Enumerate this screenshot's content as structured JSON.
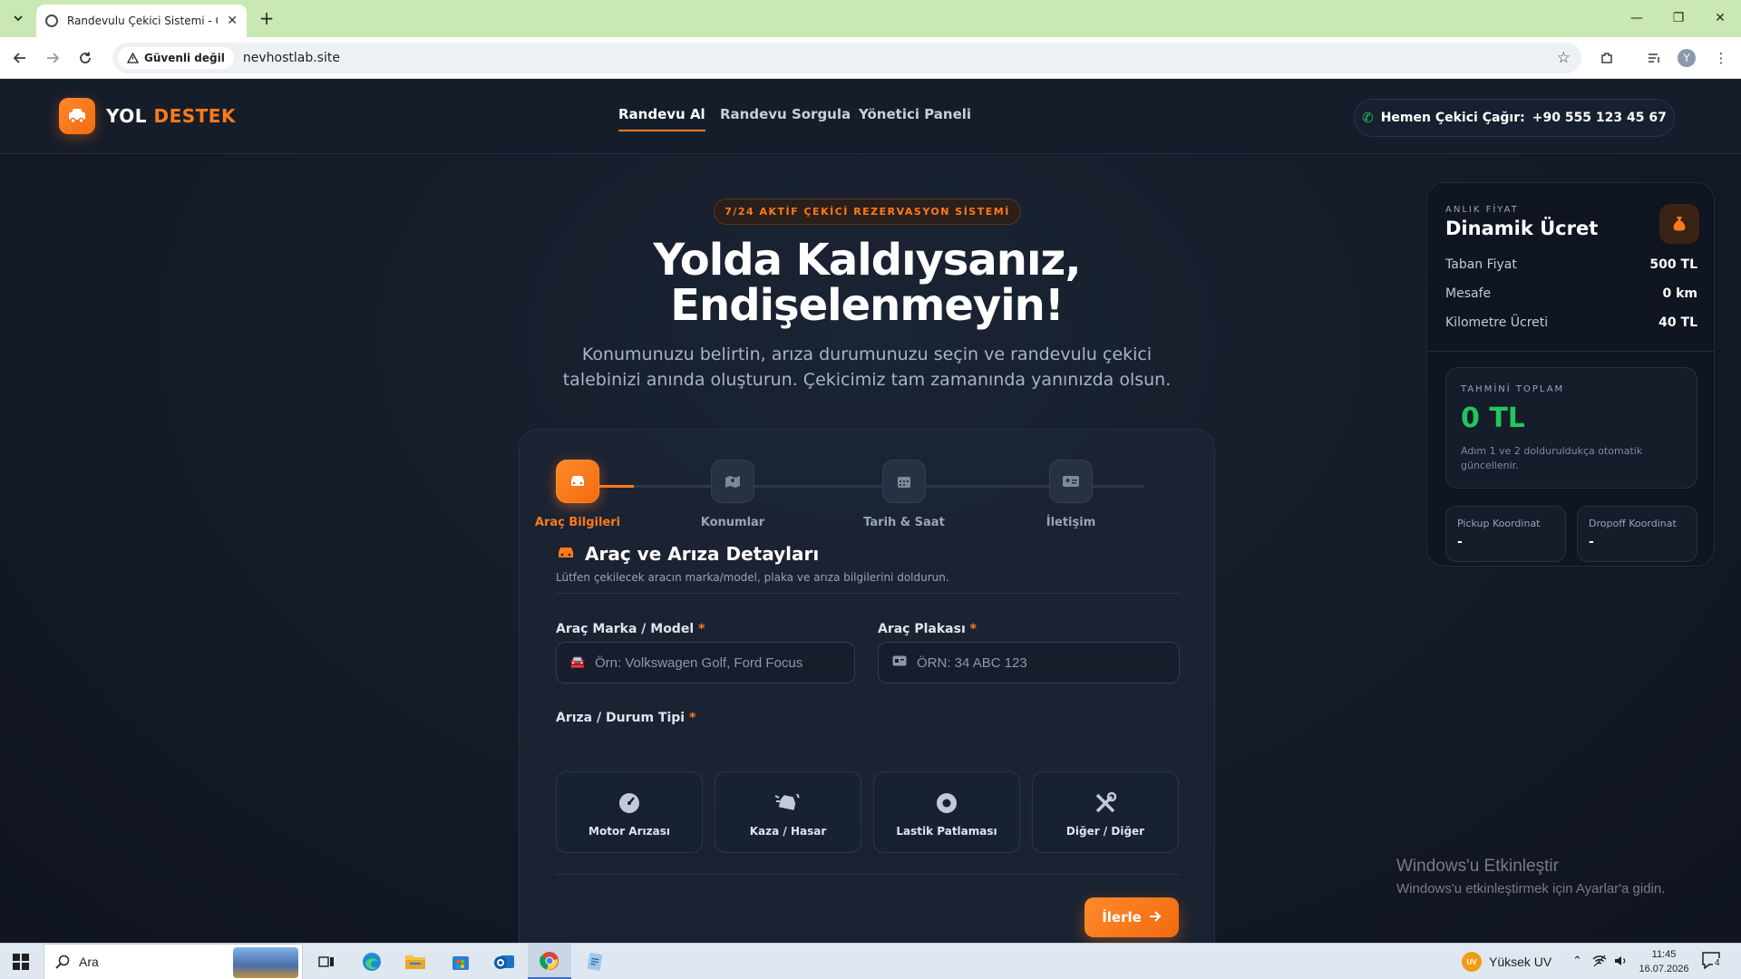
{
  "browser": {
    "tab_title": "Randevulu Çekici Sistemi - Güv",
    "security_label": "Güvenli değil",
    "url": "nevhostlab.site",
    "profile_initial": "Y"
  },
  "site": {
    "logo_word1": "YOL",
    "logo_word2": "DESTEK",
    "nav": [
      "Randevu Al",
      "Randevu Sorgula",
      "Yönetici Paneli"
    ],
    "call_label": "Hemen Çekici Çağır:",
    "call_number": "+90 555 123 45 67"
  },
  "hero": {
    "badge": "7/24 AKTİF ÇEKİCİ REZERVASYON SİSTEMİ",
    "title_line1": "Yolda Kaldıysanız,",
    "title_line2": "Endişelenmeyin!",
    "subtitle": "Konumunuzu belirtin, arıza durumunuzu seçin ve randevulu çekici talebinizi anında oluşturun. Çekicimiz tam zamanında yanınızda olsun."
  },
  "steps": [
    "Araç Bilgileri",
    "Konumlar",
    "Tarih & Saat",
    "İletişim"
  ],
  "form": {
    "section_title": "Araç ve Arıza Detayları",
    "section_desc": "Lütfen çekilecek aracın marka/model, plaka ve arıza bilgilerini doldurun.",
    "brand_label": "Araç Marka / Model",
    "brand_placeholder": "Örn: Volkswagen Golf, Ford Focus",
    "plate_label": "Araç Plakası",
    "plate_placeholder": "ÖRN: 34 ABC 123",
    "required_mark": "*",
    "fault_label": "Arıza / Durum Tipi",
    "fault_options": [
      "Motor Arızası",
      "Kaza / Hasar",
      "Lastik Patlaması",
      "Diğer / Diğer"
    ],
    "next_label": "İlerle"
  },
  "pricing": {
    "kicker": "ANLIK FİYAT",
    "title": "Dinamik Ücret",
    "rows": [
      {
        "label": "Taban Fiyat",
        "value": "500 TL"
      },
      {
        "label": "Mesafe",
        "value": "0 km"
      },
      {
        "label": "Kilometre Ücreti",
        "value": "40 TL"
      }
    ],
    "total_label": "TAHMİNİ TOPLAM",
    "total_value": "0 TL",
    "total_note": "Adım 1 ve 2 dolduruldukça otomatik güncellenir.",
    "pickup_label": "Pickup Koordinat",
    "pickup_value": "-",
    "dropoff_label": "Dropoff Koordinat",
    "dropoff_value": "-"
  },
  "watermark": {
    "title": "Windows'u Etkinleştir",
    "subtitle": "Windows'u etkinleştirmek için Ayarlar'a gidin."
  },
  "taskbar": {
    "search_placeholder": "Ara",
    "uv_badge": "UV",
    "uv_label": "Yüksek UV",
    "time": "11:45",
    "date": "16.07.2026",
    "notification_count": "4"
  },
  "colors": {
    "accent": "#ff7a1a",
    "success": "#22c55e",
    "background": "#141a26"
  }
}
